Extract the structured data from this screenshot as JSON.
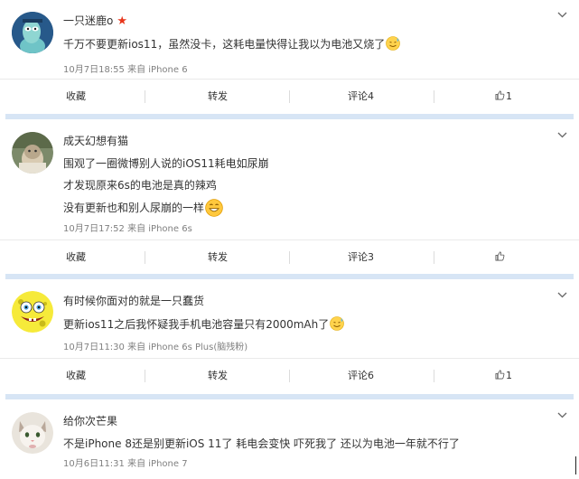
{
  "posts": [
    {
      "username": "一只迷鹿o",
      "badge_icon": "star-icon",
      "lines": [
        "千万不要更新ios11，虽然没卡，这耗电量快得让我以为电池又烧了"
      ],
      "date": "10月7日18:55",
      "via": "来自",
      "device": "iPhone 6",
      "actions": {
        "collect": "收藏",
        "repost": "转发",
        "comment": "评论",
        "comment_count": "4",
        "like_count": "1"
      }
    },
    {
      "username": "成天幻想有猫",
      "lines": [
        "围观了一圈微博别人说的iOS11耗电如尿崩",
        "才发现原来6s的电池是真的辣鸡",
        "没有更新也和别人尿崩的一样"
      ],
      "date": "10月7日17:52",
      "via": "来自",
      "device": "iPhone 6s",
      "actions": {
        "collect": "收藏",
        "repost": "转发",
        "comment": "评论",
        "comment_count": "3",
        "like_count": ""
      }
    },
    {
      "username": "有时候你面对的就是一只蠢货",
      "lines": [
        "更新ios11之后我怀疑我手机电池容量只有2000mAh了"
      ],
      "date": "10月7日11:30",
      "via": "来自",
      "device": "iPhone 6s Plus(脑残粉)",
      "actions": {
        "collect": "收藏",
        "repost": "转发",
        "comment": "评论",
        "comment_count": "6",
        "like_count": "1"
      }
    },
    {
      "username": "给你次芒果",
      "lines": [
        "不是iPhone 8还是别更新iOS 11了 耗电会变快 吓死我了 还以为电池一年就不行了"
      ],
      "date": "10月6日11:31",
      "via": "来自",
      "device": "iPhone 7"
    }
  ],
  "colors": {
    "divider": "#d7e5f5",
    "star": "#e8361b",
    "meta": "#808080"
  }
}
